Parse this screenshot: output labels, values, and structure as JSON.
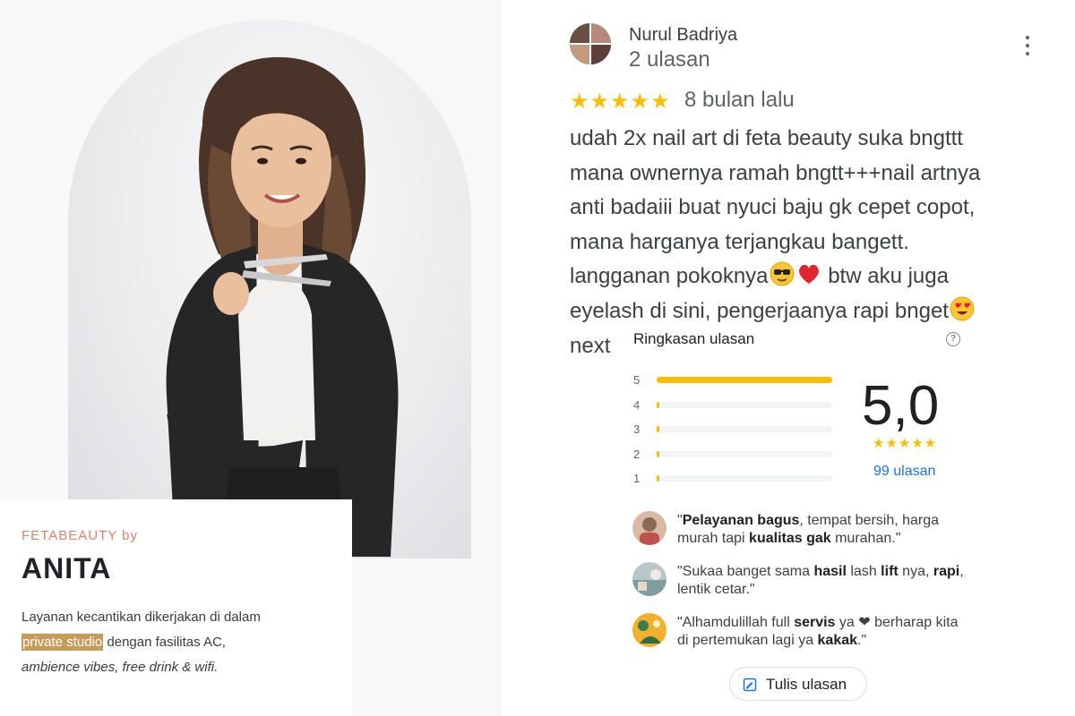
{
  "promo": {
    "brand": "FETABEAUTY by",
    "owner": "ANITA",
    "desc_line1": "Layanan kecantikan dikerjakan di dalam",
    "desc_highlight": "private studio",
    "desc_line2_rest": " dengan fasilitas AC,",
    "desc_line3": "ambience vibes, free drink & wifi.",
    "accent_color": "#d9826c",
    "highlight_color": "#c99b5a"
  },
  "review": {
    "reviewer_name": "Nurul Badriya",
    "reviewer_count": "2 ulasan",
    "stars": "★★★★★",
    "time": "8 bulan lalu",
    "text_l1": "udah 2x nail art di feta beauty suka bngttt",
    "text_l2": "mana ownernya ramah bngtt+++nail artnya",
    "text_l3": "anti badaiii buat nyuci baju gk cepet copot,",
    "text_l4": "mana harganya terjangkau bangett.",
    "text_l5_a": "langganan pokoknya",
    "text_l5_b": " btw aku juga",
    "text_l6": "eyelash di sini, pengerjaanya rapi bnget",
    "text_l7": "next",
    "more_icon": "more-vert-icon",
    "emojis": [
      "sunglasses-emoji",
      "red-heart-emoji",
      "heart-eyes-emoji"
    ]
  },
  "summary": {
    "title": "Ringkasan ulasan",
    "help_glyph": "?",
    "rating_bars": [
      {
        "label": "5",
        "fraction": 1.0
      },
      {
        "label": "4",
        "fraction": 0.01
      },
      {
        "label": "3",
        "fraction": 0.01
      },
      {
        "label": "2",
        "fraction": 0.01
      },
      {
        "label": "1",
        "fraction": 0.01
      }
    ],
    "score": "5,0",
    "score_stars": "★★★★★",
    "total_reviews": "99 ulasan",
    "snippets": [
      {
        "q1": "\"",
        "b1": "Pelayanan bagus",
        "t1": ", tempat bersih, harga murah tapi ",
        "b2": "kualitas gak",
        "t2": " murahan.\""
      },
      {
        "q1": "\"Sukaa banget sama ",
        "b1": "hasil",
        "t1": " lash ",
        "b2": "lift",
        "t2": " nya, ",
        "b3": "rapi",
        "t3": ", lentik cetar.\""
      },
      {
        "q1": "\"Alhamdulillah full ",
        "b1": "servis",
        "t1": " ya ",
        "heart": "❤",
        "t2": " berharap kita di pertemukan lagi ya ",
        "b2": "kakak",
        "t3": ".\""
      }
    ],
    "write_label": "Tulis ulasan",
    "star_color": "#fbbc04",
    "link_color": "#1a73e8"
  }
}
